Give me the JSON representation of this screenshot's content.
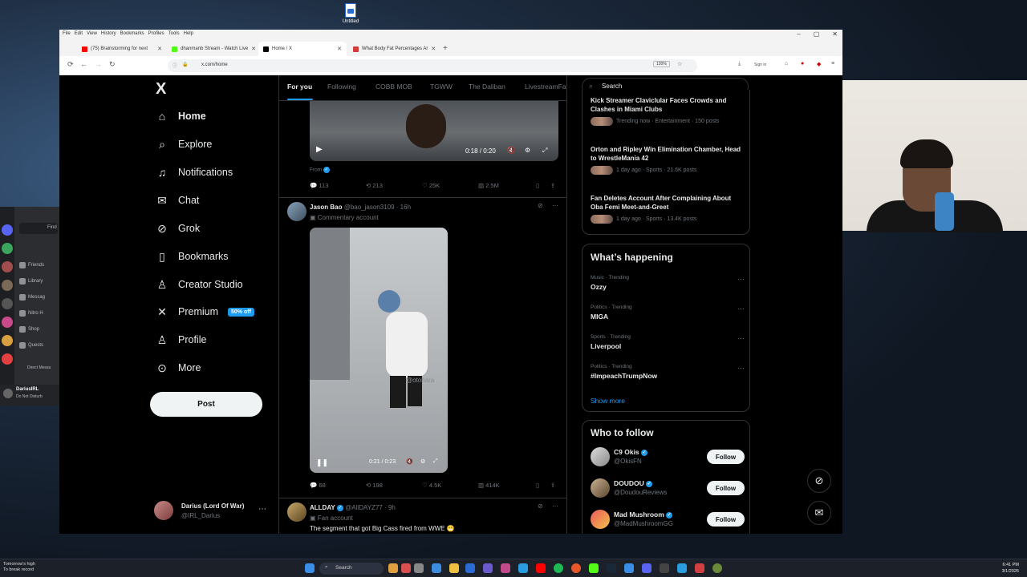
{
  "desktop": {
    "icon_label": "Untitled"
  },
  "discord": {
    "items": [
      "Find",
      "Friends",
      "Library",
      "Messag",
      "Nitro H",
      "Shop",
      "Quests"
    ],
    "section": "Direct Messa",
    "user_name": "DariusIRL",
    "user_status": "Do Not Disturb"
  },
  "browser": {
    "menu": [
      "File",
      "Edit",
      "View",
      "History",
      "Bookmarks",
      "Profiles",
      "Tools",
      "Help"
    ],
    "tabs": [
      {
        "label": "(75) Brainstorming for next",
        "color": "#ff0000"
      },
      {
        "label": "dhanmanb Stream - Watch Live",
        "color": "#53fc18"
      },
      {
        "label": "Home / X",
        "color": "#000000"
      },
      {
        "label": "What Body Fat Percentages Ar",
        "color": "#d33a3a"
      }
    ],
    "url": "x.com/home",
    "zoom": "120%",
    "sign_in": "Sign in"
  },
  "x": {
    "logo": "X",
    "nav": [
      {
        "label": "Home",
        "icon": "home-icon",
        "glyph": "⌂"
      },
      {
        "label": "Explore",
        "icon": "search-icon",
        "glyph": "⌕"
      },
      {
        "label": "Notifications",
        "icon": "bell-icon",
        "glyph": "♫"
      },
      {
        "label": "Chat",
        "icon": "envelope-icon",
        "glyph": "✉"
      },
      {
        "label": "Grok",
        "icon": "grok-icon",
        "glyph": "⊘"
      },
      {
        "label": "Bookmarks",
        "icon": "bookmark-icon",
        "glyph": "▯"
      },
      {
        "label": "Creator Studio",
        "icon": "creator-studio-icon",
        "glyph": "♙"
      },
      {
        "label": "Premium",
        "icon": "x-premium-icon",
        "glyph": "✕"
      },
      {
        "label": "Profile",
        "icon": "person-icon",
        "glyph": "♙"
      },
      {
        "label": "More",
        "icon": "more-circle-icon",
        "glyph": "⊙"
      }
    ],
    "premium_badge": "50% off",
    "post_button": "Post",
    "account": {
      "name": "Darius (Lord Of War)",
      "handle": "@IRL_Darius"
    },
    "timeline_tabs": [
      "For you",
      "Following",
      "COBB MOB",
      "TGWW",
      "The Daliban",
      "LivestreamFa"
    ],
    "tweets": [
      {
        "from_label": "From",
        "video_time": "0:18 / 0:20",
        "replies": "113",
        "reposts": "213",
        "likes": "25K",
        "views": "2.5M"
      },
      {
        "name": "Jason Bao",
        "handle": "@bao_jason3109",
        "time": "· 16h",
        "label": "Commentary account",
        "video_time": "0:21 / 0:23",
        "watermark": "@otohara",
        "replies": "68",
        "reposts": "198",
        "likes": "4.5K",
        "views": "414K"
      },
      {
        "name": "ALLDAY",
        "handle": "@AllDAYZ77",
        "time": "· 9h",
        "label": "Fan account",
        "text": "The segment that got Big Cass fired from WWE 😬"
      }
    ],
    "search_placeholder": "Search",
    "news": [
      {
        "title": "Kick Streamer Claviclular Faces Crowds and Clashes in Miami Clubs",
        "meta": "Trending now · Entertainment · 150 posts"
      },
      {
        "title": "Orton and Ripley Win Elimination Chamber, Head to WrestleMania 42",
        "meta": "1 day ago · Sports · 21.6K posts"
      },
      {
        "title": "Fan Deletes Account After Complaining About Oba Femi Meet-and-Greet",
        "meta": "1 day ago · Sports · 13.4K posts"
      }
    ],
    "whats_happening": {
      "title": "What’s happening",
      "trends": [
        {
          "context": "Music · Trending",
          "name": "Ozzy"
        },
        {
          "context": "Politics · Trending",
          "name": "MIGA"
        },
        {
          "context": "Sports · Trending",
          "name": "Liverpool"
        },
        {
          "context": "Politics · Trending",
          "name": "#ImpeachTrumpNow"
        }
      ],
      "show_more": "Show more"
    },
    "who_to_follow": {
      "title": "Who to follow",
      "users": [
        {
          "name": "C9 Okis",
          "handle": "@OkisFN",
          "button": "Follow"
        },
        {
          "name": "DOUDOU",
          "handle": "@DoudouReviews",
          "button": "Follow"
        },
        {
          "name": "Mad Mushroom",
          "handle": "@MadMushroomGG",
          "button": "Follow"
        }
      ]
    }
  },
  "taskbar": {
    "weather_line1": "Tomorrow's high",
    "weather_line2": "To break record",
    "search": "Search",
    "time": "6:41 PM",
    "date": "3/1/2026"
  }
}
